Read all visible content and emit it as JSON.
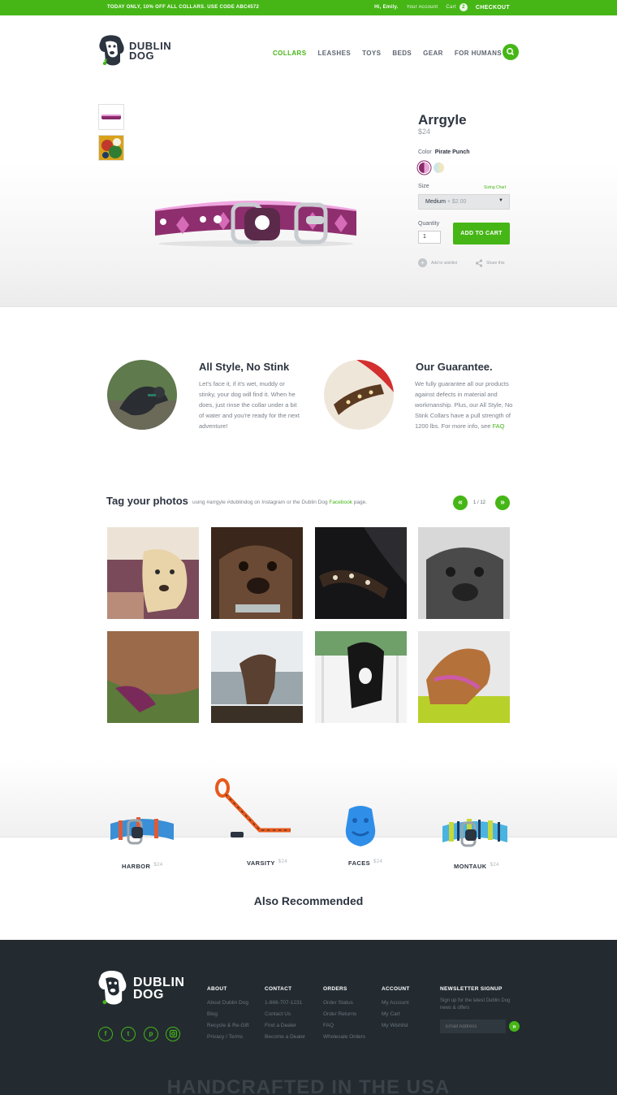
{
  "topbar": {
    "promo": "TODAY ONLY, 10% OFF ALL COLLARS.  USE CODE ABC4572",
    "greeting": "Hi, Emily.",
    "account": "Your Account",
    "cart": "Cart",
    "cart_count": "2",
    "checkout": "CHECKOUT"
  },
  "logo": {
    "line1": "DUBLIN",
    "line2": "DOG"
  },
  "nav": {
    "items": [
      "COLLARS",
      "LEASHES",
      "TOYS",
      "BEDS",
      "GEAR",
      "FOR HUMANS"
    ],
    "active": "COLLARS"
  },
  "product": {
    "title": "Arrgyle",
    "price": "$24",
    "color_label": "Color",
    "color_value": "Pirate Punch",
    "size_label": "Size",
    "sizing_chart": "Sizing Chart",
    "size_value": "Medium",
    "size_modifier": "+ $2.00",
    "quantity_label": "Quantity",
    "quantity_value": "1",
    "add_to_cart": "ADD TO CART",
    "wishlist": "Add to wishlist",
    "share": "Share this"
  },
  "features": [
    {
      "title": "All Style, No Stink",
      "body": "Let's face it, if it's wet, muddy or stinky, your dog will find it. When he does, just rinse the collar under a bit of water and you're ready for the next adventure!"
    },
    {
      "title": "Our Guarantee.",
      "body": "We fully guarantee all our products against defects in material and workmanship. Plus, our All Style, No Stink Collars have a pull strength of 1200 lbs. For more info, see",
      "link": "FAQ"
    }
  ],
  "tag": {
    "title": "Tag your photos",
    "sub_before": "using #arrgyle #dublindog on Instagram or the Dublin Dog",
    "sub_link": "Facebook",
    "sub_after": "page.",
    "pager": "1 / 12"
  },
  "recommended": {
    "heading": "Also Recommended",
    "items": [
      {
        "name": "HARBOR",
        "price": "$24"
      },
      {
        "name": "VARSITY",
        "price": "$24"
      },
      {
        "name": "FACES",
        "price": "$24"
      },
      {
        "name": "MONTAUK",
        "price": "$24"
      }
    ]
  },
  "footer": {
    "about": {
      "heading": "ABOUT",
      "links": [
        "About Dublin Dog",
        "Blog",
        "Recycle & Re-Gift",
        "Privacy / Terms"
      ]
    },
    "contact": {
      "heading": "CONTACT",
      "links": [
        "1-866-707-1231",
        "Contact Us",
        "Find a Dealer",
        "Become a Dealer"
      ]
    },
    "orders": {
      "heading": "ORDERS",
      "links": [
        "Order Status",
        "Order Returns",
        "FAQ",
        "Wholesale Orders"
      ]
    },
    "account": {
      "heading": "ACCOUNT",
      "links": [
        "My Account",
        "My Cart",
        "My Wishlist"
      ]
    },
    "newsletter": {
      "heading": "NEWSLETTER SIGNUP",
      "sub": "Sign up for the latest Dublin Dog news & offers",
      "placeholder": "Email Address"
    },
    "tagline": "HANDCRAFTED IN THE USA"
  },
  "colors": {
    "brand_green": "#45b616",
    "navy": "#2c3440",
    "footer_bg": "#232b31"
  },
  "swatches": [
    "#8a2a6a",
    "#cfe6e6"
  ]
}
